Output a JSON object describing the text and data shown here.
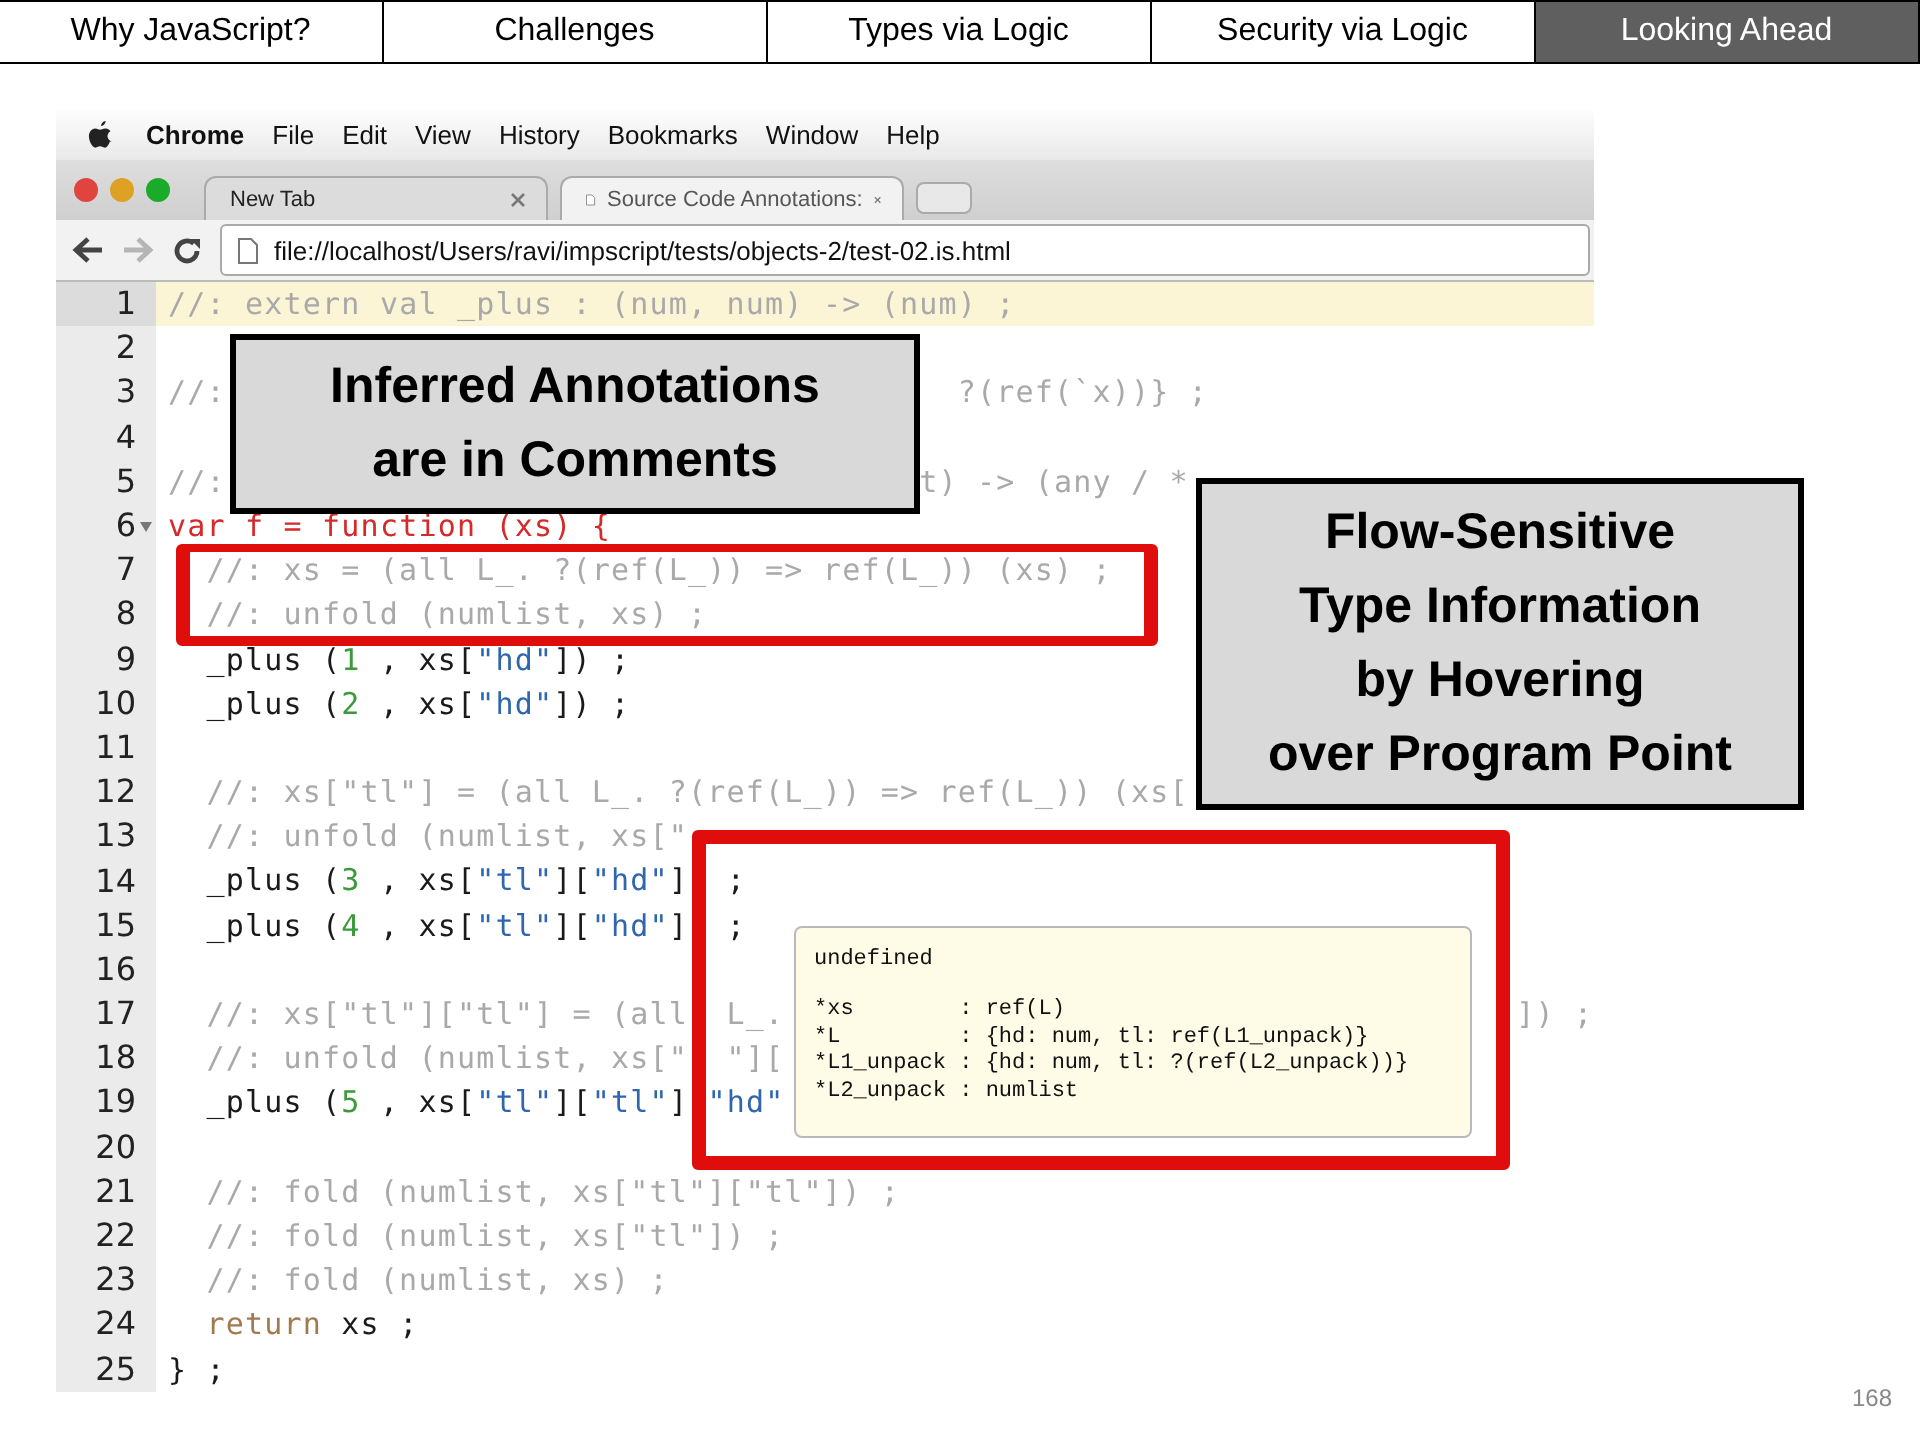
{
  "slide_nav": [
    {
      "label": "Why JavaScript?",
      "selected": false
    },
    {
      "label": "Challenges",
      "selected": false
    },
    {
      "label": "Types via Logic",
      "selected": false
    },
    {
      "label": "Security via Logic",
      "selected": false
    },
    {
      "label": "Looking Ahead",
      "selected": true
    }
  ],
  "browser": {
    "menu_bar": {
      "app": "Chrome",
      "items": [
        "File",
        "Edit",
        "View",
        "History",
        "Bookmarks",
        "Window",
        "Help"
      ]
    },
    "tabs": [
      {
        "title": "New Tab",
        "selected": false
      },
      {
        "title": "Source Code Annotations:",
        "selected": true
      }
    ],
    "nav_buttons": [
      {
        "kind": "back",
        "disabled": false
      },
      {
        "kind": "forward",
        "disabled": true
      },
      {
        "kind": "reload",
        "disabled": false
      }
    ],
    "address": "file://localhost/Users/ravi/impscript/tests/objects-2/test-02.is.html"
  },
  "editor": {
    "lines": [
      {
        "number": "1",
        "current": true,
        "foldable": false,
        "segments": [
          {
            "tokens": [
              {
                "kind": "comment",
                "text": "//: extern val _plus : (num, num) -> (num) ;"
              }
            ]
          }
        ]
      },
      {
        "number": "2",
        "current": false,
        "foldable": false
      },
      {
        "number": "3",
        "current": false,
        "foldable": false,
        "segments": [
          {
            "tokens": [
              {
                "kind": "comment",
                "text": "//:"
              }
            ]
          },
          {
            "tokens": [
              {
                "kind": "comment",
                "text": "?(ref(`x))} ;"
              }
            ]
          }
        ]
      },
      {
        "number": "4",
        "current": false,
        "foldable": false
      },
      {
        "number": "5",
        "current": false,
        "foldable": false,
        "segments": [
          {
            "tokens": [
              {
                "kind": "comment",
                "text": "//:"
              }
            ]
          },
          {
            "tokens": [
              {
                "kind": "comment",
                "text": "t) -> (any / *"
              }
            ]
          }
        ]
      },
      {
        "number": "6",
        "current": false,
        "foldable": true,
        "segments": [
          {
            "tokens": [
              {
                "kind": "error",
                "text": "var f = function (xs) {"
              }
            ]
          }
        ]
      },
      {
        "number": "7",
        "current": false,
        "foldable": false,
        "segments": [
          {
            "tokens": [
              {
                "kind": "comment",
                "text": "//: xs = (all L_. ?(ref(L_)) => ref(L_)) (xs) ;"
              }
            ]
          }
        ]
      },
      {
        "number": "8",
        "current": false,
        "foldable": false,
        "segments": [
          {
            "tokens": [
              {
                "kind": "comment",
                "text": "//: unfold (numlist, xs) ;"
              }
            ]
          }
        ]
      },
      {
        "number": "9",
        "current": false,
        "foldable": false,
        "segments": [
          {
            "tokens": [
              {
                "kind": "code",
                "text": "_plus ("
              },
              {
                "kind": "number",
                "text": "1"
              },
              {
                "kind": "code",
                "text": " , xs["
              },
              {
                "kind": "string",
                "text": "\"hd\""
              },
              {
                "kind": "code",
                "text": "]) ;"
              }
            ]
          }
        ]
      },
      {
        "number": "10",
        "current": false,
        "foldable": false,
        "segments": [
          {
            "tokens": [
              {
                "kind": "code",
                "text": "_plus ("
              },
              {
                "kind": "number",
                "text": "2"
              },
              {
                "kind": "code",
                "text": " , xs["
              },
              {
                "kind": "string",
                "text": "\"hd\""
              },
              {
                "kind": "code",
                "text": "]) ;"
              }
            ]
          }
        ]
      },
      {
        "number": "11",
        "current": false,
        "foldable": false
      },
      {
        "number": "12",
        "current": false,
        "foldable": false,
        "segments": [
          {
            "tokens": [
              {
                "kind": "comment",
                "text": "//: xs[\"tl\"] = (all L_. ?(ref(L_)) => ref(L_)) (xs["
              }
            ]
          }
        ]
      },
      {
        "number": "13",
        "current": false,
        "foldable": false,
        "segments": [
          {
            "tokens": [
              {
                "kind": "comment",
                "text": "//: unfold (numlist, xs[\""
              }
            ]
          }
        ]
      },
      {
        "number": "14",
        "current": false,
        "foldable": false,
        "segments": [
          {
            "tokens": [
              {
                "kind": "code",
                "text": "_plus ("
              },
              {
                "kind": "number",
                "text": "3"
              },
              {
                "kind": "code",
                "text": " , xs["
              },
              {
                "kind": "string",
                "text": "\"tl\""
              },
              {
                "kind": "code",
                "text": "]["
              },
              {
                "kind": "string",
                "text": "\"hd\""
              },
              {
                "kind": "code",
                "text": "]"
              }
            ]
          },
          {
            "tokens": [
              {
                "kind": "code",
                "text": ";"
              }
            ]
          }
        ]
      },
      {
        "number": "15",
        "current": false,
        "foldable": false,
        "segments": [
          {
            "tokens": [
              {
                "kind": "code",
                "text": "_plus ("
              },
              {
                "kind": "number",
                "text": "4"
              },
              {
                "kind": "code",
                "text": " , xs["
              },
              {
                "kind": "string",
                "text": "\"tl\""
              },
              {
                "kind": "code",
                "text": "]["
              },
              {
                "kind": "string",
                "text": "\"hd\""
              },
              {
                "kind": "code",
                "text": "]"
              }
            ]
          },
          {
            "tokens": [
              {
                "kind": "code",
                "text": ";"
              }
            ]
          }
        ]
      },
      {
        "number": "16",
        "current": false,
        "foldable": false
      },
      {
        "number": "17",
        "current": false,
        "foldable": false,
        "segments": [
          {
            "tokens": [
              {
                "kind": "comment",
                "text": "//: xs[\"tl\"][\"tl\"] = (all"
              }
            ]
          },
          {
            "tokens": [
              {
                "kind": "comment",
                "text": "L_."
              }
            ]
          },
          {
            "tokens": [
              {
                "kind": "comment",
                "text": "]) ;"
              }
            ]
          }
        ]
      },
      {
        "number": "18",
        "current": false,
        "foldable": false,
        "segments": [
          {
            "tokens": [
              {
                "kind": "comment",
                "text": "//: unfold (numlist, xs[\""
              }
            ]
          },
          {
            "tokens": [
              {
                "kind": "comment",
                "text": "\"]["
              }
            ]
          }
        ]
      },
      {
        "number": "19",
        "current": false,
        "foldable": false,
        "segments": [
          {
            "tokens": [
              {
                "kind": "code",
                "text": "_plus ("
              },
              {
                "kind": "number",
                "text": "5"
              },
              {
                "kind": "code",
                "text": " , xs["
              },
              {
                "kind": "string",
                "text": "\"tl\""
              },
              {
                "kind": "code",
                "text": "]["
              },
              {
                "kind": "string",
                "text": "\"tl\""
              },
              {
                "kind": "code",
                "text": "]"
              }
            ]
          },
          {
            "tokens": [
              {
                "kind": "string",
                "text": "\"hd\""
              }
            ]
          }
        ]
      },
      {
        "number": "20",
        "current": false,
        "foldable": false
      },
      {
        "number": "21",
        "current": false,
        "foldable": false,
        "segments": [
          {
            "tokens": [
              {
                "kind": "comment",
                "text": "//: fold (numlist, xs[\"tl\"][\"tl\"]) ;"
              }
            ]
          }
        ]
      },
      {
        "number": "22",
        "current": false,
        "foldable": false,
        "segments": [
          {
            "tokens": [
              {
                "kind": "comment",
                "text": "//: fold (numlist, xs[\"tl\"]) ;"
              }
            ]
          }
        ]
      },
      {
        "number": "23",
        "current": false,
        "foldable": false,
        "segments": [
          {
            "tokens": [
              {
                "kind": "comment",
                "text": "//: fold (numlist, xs) ;"
              }
            ]
          }
        ]
      },
      {
        "number": "24",
        "current": false,
        "foldable": false,
        "segments": [
          {
            "tokens": [
              {
                "kind": "keyword",
                "text": "return"
              },
              {
                "kind": "code",
                "text": " xs ;"
              }
            ]
          }
        ]
      },
      {
        "number": "25",
        "current": false,
        "foldable": false,
        "segments": [
          {
            "tokens": [
              {
                "kind": "code",
                "text": "} ;"
              }
            ]
          }
        ]
      }
    ]
  },
  "tooltip": {
    "title": "undefined",
    "rows": [
      "*xs        : ref(L)",
      "*L         : {hd: num, tl: ref(L1_unpack)}",
      "*L1_unpack : {hd: num, tl: ?(ref(L2_unpack))}",
      "*L2_unpack : numlist"
    ]
  },
  "callouts": [
    {
      "lines": [
        "Inferred Annotations",
        "are in Comments"
      ]
    },
    {
      "lines": [
        "Flow-Sensitive",
        "Type Information",
        "by Hovering",
        "over Program Point"
      ]
    }
  ],
  "page_number": "168"
}
